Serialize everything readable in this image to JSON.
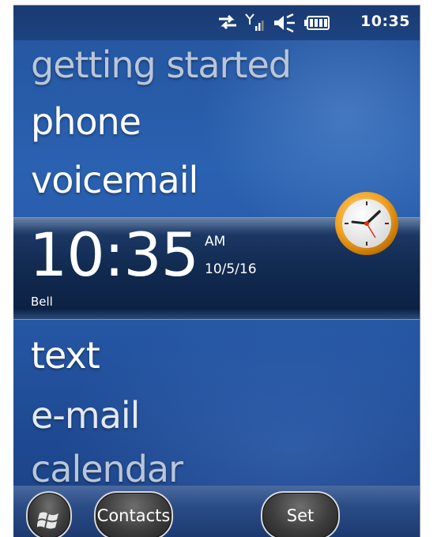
{
  "status_bar": {
    "icons": [
      "data-sync-icon",
      "signal-icon",
      "speaker-icon",
      "battery-icon"
    ],
    "time": "10:35"
  },
  "menu": {
    "items_above": [
      "getting started",
      "phone",
      "voicemail"
    ],
    "items_below": [
      "text",
      "e-mail",
      "calendar"
    ]
  },
  "clock": {
    "time": "10:35",
    "ampm": "AM",
    "date": "10/5/16",
    "alarm_label": "Bell",
    "icon": "clock-icon"
  },
  "softkeys": {
    "left_icon": "windows-start-icon",
    "contacts_label": "Contacts",
    "set_label": "Set"
  },
  "colors": {
    "background": "#275aa8",
    "status_bar": "#193a72",
    "clock_band": "#112a50",
    "clock_face_rim": "#f0a020"
  }
}
